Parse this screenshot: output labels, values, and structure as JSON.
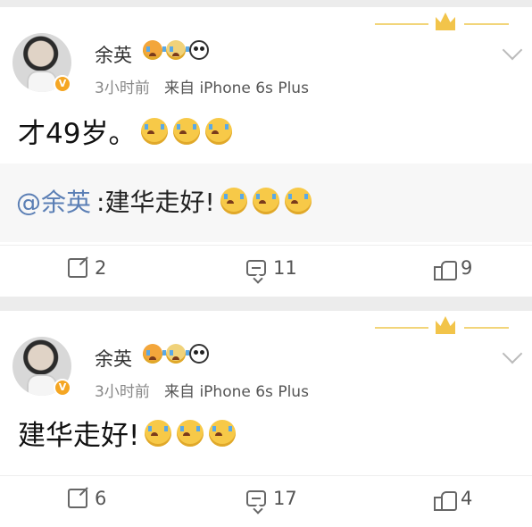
{
  "posts": [
    {
      "username": "余英",
      "time": "3小时前",
      "source": "来自 iPhone 6s Plus",
      "text": "才49岁。",
      "emoji_names": [
        "crying-face",
        "crying-face",
        "crying-face"
      ],
      "repost": {
        "mention": "@余英",
        "text": ":建华走好!"
      },
      "actions": {
        "repost": "2",
        "comments": "11",
        "likes": "9"
      }
    },
    {
      "username": "余英",
      "time": "3小时前",
      "source": "来自 iPhone 6s Plus",
      "text": "建华走好!",
      "emoji_names": [
        "crying-face",
        "crying-face",
        "crying-face"
      ],
      "actions": {
        "repost": "6",
        "comments": "17",
        "likes": "4"
      }
    }
  ],
  "colors": {
    "mention": "#5b7fb5",
    "accent_gold": "#f5a623"
  }
}
